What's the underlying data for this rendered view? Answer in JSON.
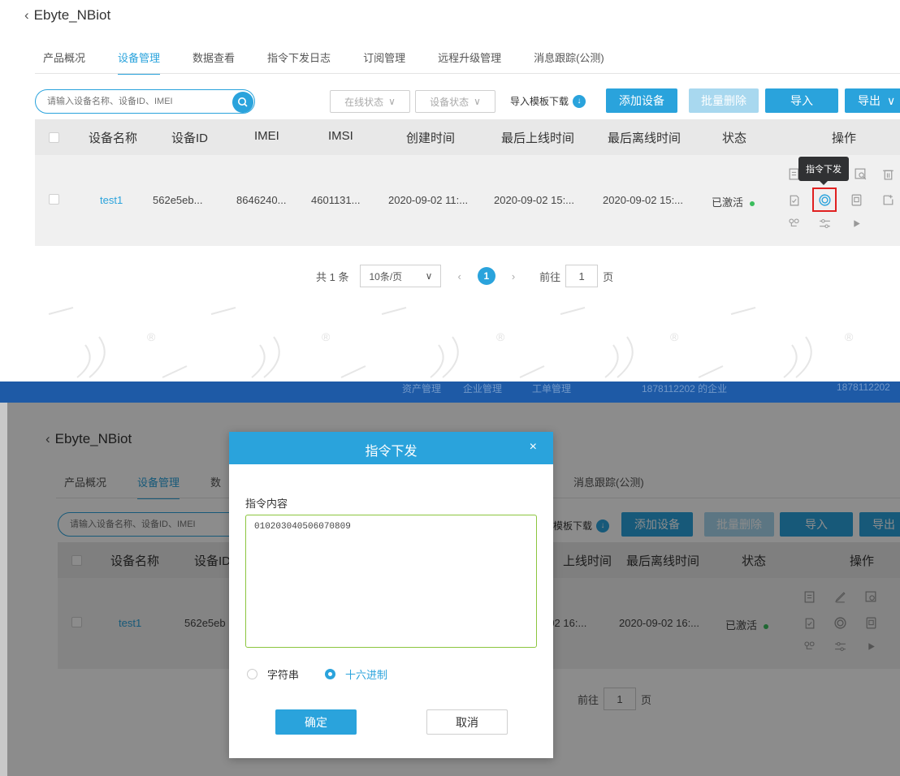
{
  "top": {
    "back_icon": "‹",
    "title": "Ebyte_NBiot",
    "tabs": [
      "产品概况",
      "设备管理",
      "数据查看",
      "指令下发日志",
      "订阅管理",
      "远程升级管理",
      "消息跟踪(公测)"
    ],
    "search_placeholder": "请输入设备名称、设备ID、IMEI",
    "online_status": "在线状态",
    "device_status": "设备状态",
    "import_template": "导入模板下载",
    "add_device": "添加设备",
    "batch_delete": "批量删除",
    "import": "导入",
    "export": "导出",
    "columns": [
      "设备名称",
      "设备ID",
      "IMEI",
      "IMSI",
      "创建时间",
      "最后上线时间",
      "最后离线时间",
      "状态",
      "操作"
    ],
    "row": {
      "name": "test1",
      "device_id": "562e5eb...",
      "imei": "8646240...",
      "imsi": "4601131...",
      "created": "2020-09-02 11:...",
      "last_online": "2020-09-02 15:...",
      "last_offline": "2020-09-02 15:...",
      "status": "已激活"
    },
    "tooltip": "指令下发",
    "total": "共 1 条",
    "page_size": "10条/页",
    "current_page": "1",
    "goto_label": "前往",
    "goto_value": "1",
    "page_unit": "页"
  },
  "watermark_mark": "®",
  "bottom": {
    "header_items": [
      "资产管理",
      "企业管理",
      "工单管理",
      "1878112202 的企业",
      "1878112202"
    ],
    "back_icon": "‹",
    "title": "Ebyte_NBiot",
    "tabs": [
      "产品概况",
      "设备管理",
      "数"
    ],
    "tab_hidden": "消息跟踪(公测)",
    "search_placeholder": "请输入设备名称、设备ID、IMEI",
    "import_template": "模板下载",
    "add_device": "添加设备",
    "batch_delete": "批量删除",
    "import": "导入",
    "export": "导出",
    "columns_left": [
      "设备名称",
      "设备ID"
    ],
    "columns_right": [
      "上线时间",
      "最后离线时间",
      "状态",
      "操作"
    ],
    "row": {
      "name": "test1",
      "device_id": "562e5eb",
      "last_online": "-02 16:...",
      "last_offline": "2020-09-02 16:...",
      "status": "已激活"
    },
    "goto_label": "前往",
    "goto_value": "1",
    "page_unit": "页"
  },
  "dialog": {
    "title": "指令下发",
    "close_icon": "×",
    "label": "指令内容",
    "content": "010203040506070809",
    "radio_string": "字符串",
    "radio_hex": "十六进制",
    "selected": "十六进制",
    "ok": "确定",
    "cancel": "取消"
  },
  "colors": {
    "accent": "#2aa3dc",
    "active_status": "#3bbd5d",
    "highlight_box": "#e02020",
    "header_bar": "#1e5aa6"
  }
}
